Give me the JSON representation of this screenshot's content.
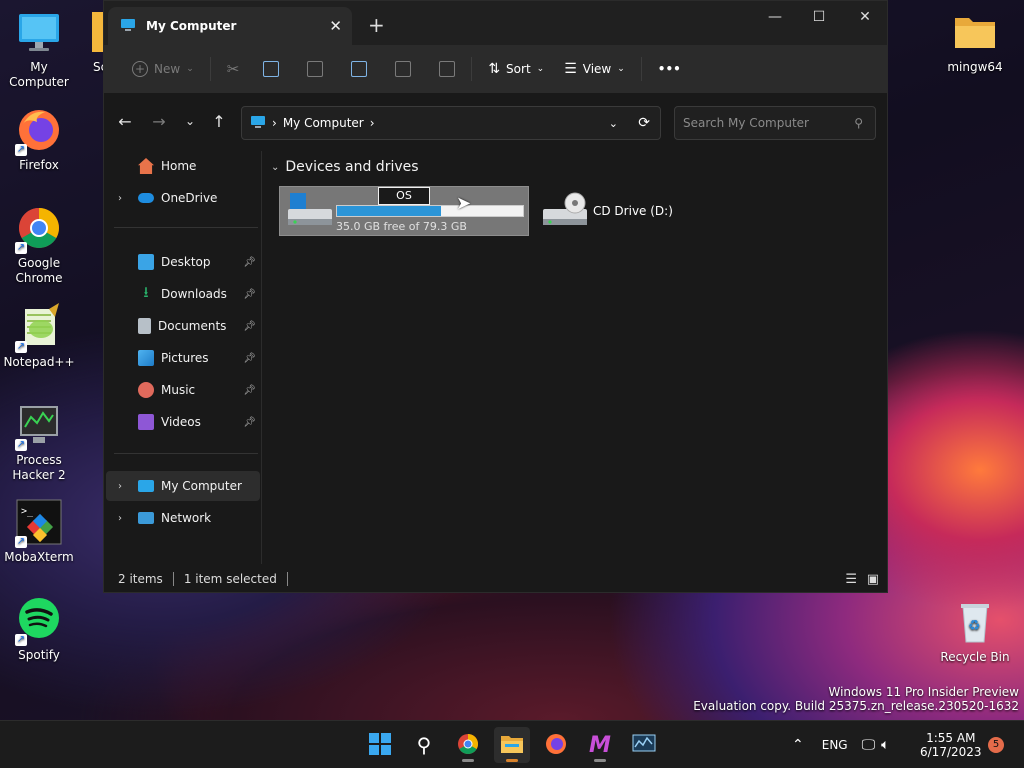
{
  "desktop": {
    "icons": {
      "my_computer": "My Computer",
      "firefox": "Firefox",
      "chrome_line1": "Google",
      "chrome_line2": "Chrome",
      "notepadpp": "Notepad++",
      "process_hacker_line1": "Process",
      "process_hacker_line2": "Hacker 2",
      "mobaxterm": "MobaXterm",
      "spotify": "Spotify",
      "partial_sc": "Sc",
      "mingw64": "mingw64",
      "recycle_bin": "Recycle Bin"
    },
    "watermark": {
      "line1": "Windows 11 Pro Insider Preview",
      "line2": "Evaluation copy. Build 25375.zn_release.230520-1632"
    }
  },
  "window": {
    "tab_title": "My Computer",
    "toolbar": {
      "new_label": "New",
      "sort_label": "Sort",
      "view_label": "View",
      "more_label": "•••"
    },
    "address": {
      "crumb": "My Computer",
      "separator": "›"
    },
    "search": {
      "placeholder": "Search My Computer"
    },
    "sidebar": {
      "home": "Home",
      "onedrive": "OneDrive",
      "desktop": "Desktop",
      "downloads": "Downloads",
      "documents": "Documents",
      "pictures": "Pictures",
      "music": "Music",
      "videos": "Videos",
      "my_computer": "My Computer",
      "network": "Network"
    },
    "content": {
      "group_title": "Devices and drives",
      "drive_c": {
        "rename_value": "OS",
        "usage_fraction": 0.56,
        "free_text": "35.0 GB free of 79.3 GB"
      },
      "drive_d": {
        "label": "CD Drive (D:)"
      }
    },
    "status": {
      "items": "2 items",
      "selected": "1 item selected"
    }
  },
  "taskbar": {
    "tray": {
      "language": "ENG",
      "time": "1:55 AM",
      "date": "6/17/2023",
      "notification_count": "5"
    }
  },
  "colors": {
    "accent": "#2b95d8",
    "window_bg": "#191919",
    "selection": "#777777"
  }
}
